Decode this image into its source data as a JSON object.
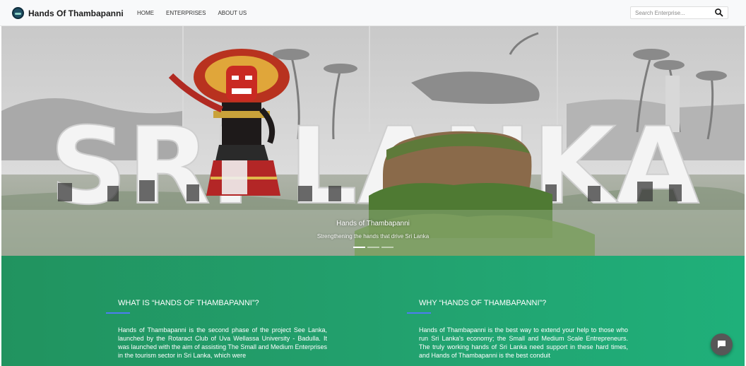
{
  "navbar": {
    "brand": "Hands Of Thambapanni",
    "links": [
      "HOME",
      "ENTERPRISES",
      "ABOUT US"
    ],
    "search_placeholder": "Search Enterprise..."
  },
  "hero": {
    "big_text": "SRI LANKA",
    "caption_title": "Hands of Thambapanni",
    "caption_subtitle": "Strengthening the hands that drive Sri Lanka",
    "slides_total": 3,
    "active_slide": 1
  },
  "info": {
    "left": {
      "heading": "WHAT IS “HANDS OF THAMBAPANNI”?",
      "body": "Hands of Thambapanni is the second phase of the project See Lanka, launched by the Rotaract Club of Uva Wellassa University - Badulla. It was launched with the aim of assisting The Small and Medium Enterprises in the tourism sector in Sri Lanka, which were"
    },
    "right": {
      "heading": "WHY “HANDS OF THAMBAPANNI”?",
      "body": "Hands of Thambapanni is the best way to extend your help to those who run Sri Lanka's economy; the Small and Medium Scale Entrepreneurs. The truly working hands of Sri Lanka need support in these hard times, and Hands of Thambapanni is the best conduit"
    }
  },
  "colors": {
    "section_green": "#22a370",
    "accent_blue": "#4e7cf2",
    "chat_button": "#575757"
  }
}
